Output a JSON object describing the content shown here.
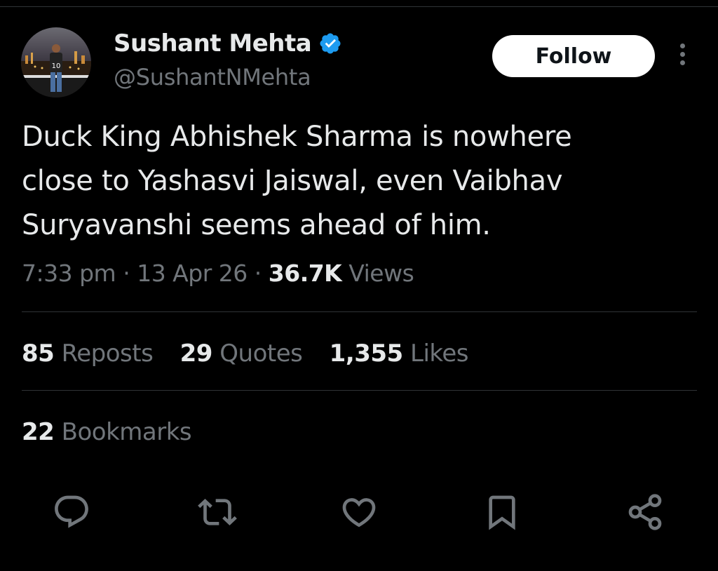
{
  "author": {
    "display_name": "Sushant Mehta",
    "handle": "@SushantNMehta",
    "verified": true,
    "avatar_jersey_number": "10"
  },
  "follow_button": {
    "label": "Follow"
  },
  "tweet": {
    "text_lines": [
      "Duck King Abhishek Sharma is nowhere",
      "close to Yashasvi Jaiswal, even Vaibhav",
      "Suryavanshi seems ahead of him."
    ],
    "time": "7:33 pm",
    "separator": "·",
    "date": "13 Apr 26",
    "views_count": "36.7K",
    "views_label": "Views"
  },
  "stats": {
    "reposts": {
      "count": "85",
      "label": "Reposts"
    },
    "quotes": {
      "count": "29",
      "label": "Quotes"
    },
    "likes": {
      "count": "1,355",
      "label": "Likes"
    },
    "bookmarks": {
      "count": "22",
      "label": "Bookmarks"
    }
  },
  "actions": [
    "reply-icon",
    "repost-icon",
    "like-icon",
    "bookmark-icon",
    "share-icon"
  ],
  "colors": {
    "background": "#000000",
    "text_primary": "#e7e9ea",
    "text_secondary": "#71767b",
    "divider": "#2f3336",
    "verified_badge": "#1d9bf0",
    "follow_bg": "#ffffff"
  }
}
